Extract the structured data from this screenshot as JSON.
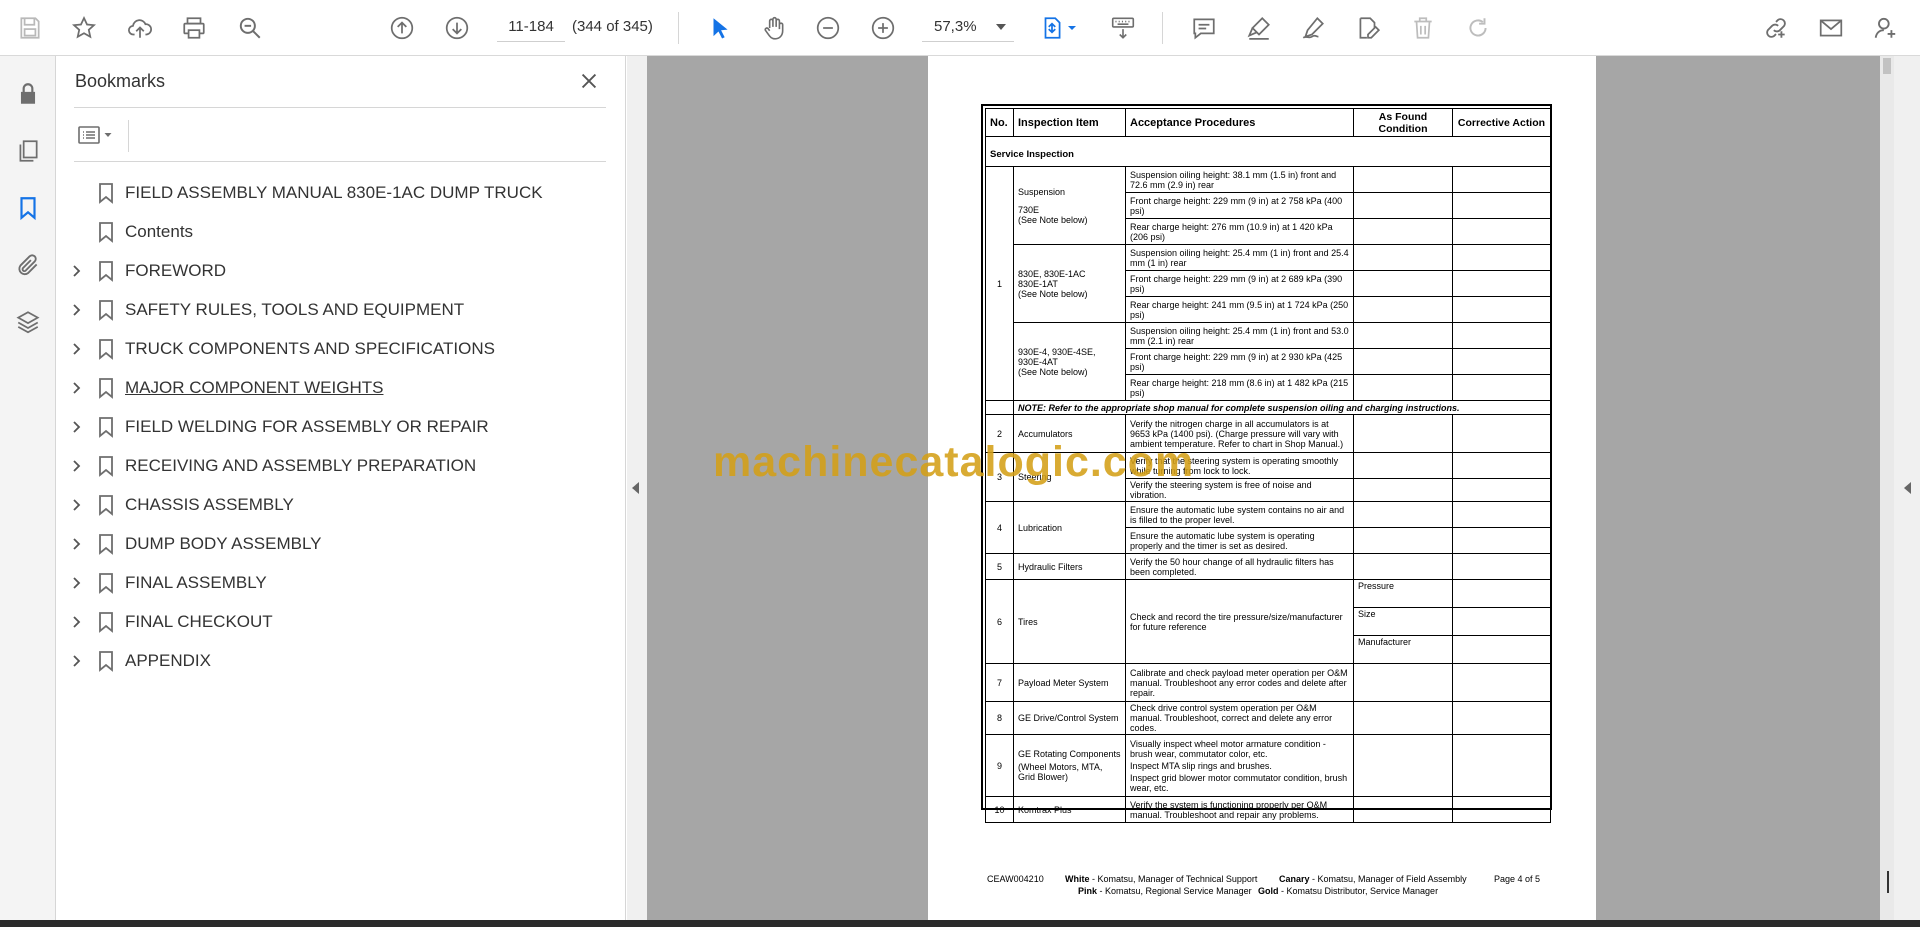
{
  "toolbar": {
    "page_input": "11-184",
    "page_count": "(344 of 345)",
    "zoom": "57,3%"
  },
  "bookmarks": {
    "title": "Bookmarks",
    "items": [
      {
        "label": "FIELD ASSEMBLY MANUAL 830E-1AC  DUMP TRUCK",
        "expandable": false
      },
      {
        "label": "Contents",
        "expandable": false
      },
      {
        "label": "FOREWORD",
        "expandable": true
      },
      {
        "label": "SAFETY RULES, TOOLS AND EQUIPMENT",
        "expandable": true
      },
      {
        "label": "TRUCK COMPONENTS AND SPECIFICATIONS",
        "expandable": true
      },
      {
        "label": "MAJOR COMPONENT WEIGHTS",
        "expandable": true
      },
      {
        "label": "FIELD WELDING FOR ASSEMBLY OR REPAIR",
        "expandable": true
      },
      {
        "label": "RECEIVING AND ASSEMBLY PREPARATION",
        "expandable": true
      },
      {
        "label": "CHASSIS ASSEMBLY",
        "expandable": true
      },
      {
        "label": "DUMP BODY ASSEMBLY",
        "expandable": true
      },
      {
        "label": "FINAL ASSEMBLY",
        "expandable": true
      },
      {
        "label": "FINAL CHECKOUT",
        "expandable": true
      },
      {
        "label": "APPENDIX",
        "expandable": true
      }
    ]
  },
  "document": {
    "headers": {
      "no": "No.",
      "item": "Inspection Item",
      "proc": "Acceptance Procedures",
      "found": "As Found Condition",
      "action": "Corrective Action"
    },
    "section": "Service Inspection",
    "rows": {
      "r1": {
        "num": "1",
        "a_item": "Suspension",
        "a_sub": "730E",
        "a_sub2": "(See Note below)",
        "a_p1": "Suspension oiling height: 38.1 mm (1.5 in) front and 72.6 mm (2.9 in) rear",
        "a_p2": "Front charge height: 229 mm (9 in) at 2 758 kPa (400 psi)",
        "a_p3": "Rear charge height: 276 mm (10.9 in) at 1 420 kPa (206 psi)",
        "b_item": "830E, 830E-1AC",
        "b_sub": "830E-1AT",
        "b_sub2": "(See Note below)",
        "b_p1": "Suspension oiling height: 25.4 mm (1 in) front and 25.4 mm (1 in) rear",
        "b_p2": "Front charge height:  229 mm (9 in) at 2 689 kPa (390 psi)",
        "b_p3": "Rear charge height: 241 mm (9.5 in) at 1 724 kPa (250 psi)",
        "c_item": "930E-4, 930E-4SE, 930E-4AT",
        "c_sub2": "(See Note below)",
        "c_p1": "Suspension oiling height: 25.4 mm (1 in) front and 53.0 mm (2.1 in) rear",
        "c_p2": "Front charge height: 229 mm (9 in) at 2 930 kPa (425 psi)",
        "c_p3": "Rear charge height: 218 mm (8.6 in) at 1 482 kPa (215 psi)",
        "note": "NOTE: Refer to the appropriate shop manual for complete suspension oiling and charging instructions."
      },
      "r2": {
        "num": "2",
        "item": "Accumulators",
        "proc": "Verify the nitrogen charge in all accumulators is at 9653 kPa (1400 psi). (Charge pressure will vary with ambient temperature. Refer to chart in Shop Manual.)"
      },
      "r3": {
        "num": "3",
        "item": "Steering",
        "p1": "Verify that the steering system is operating smoothly while turning from lock to lock.",
        "p2": "Verify the steering system is free of noise and vibration."
      },
      "r4": {
        "num": "4",
        "item": "Lubrication",
        "p1": "Ensure the automatic lube system contains no air and is filled to the proper level.",
        "p2": "Ensure the automatic lube system is operating properly and the timer is set as desired."
      },
      "r5": {
        "num": "5",
        "item": "Hydraulic Filters",
        "proc": "Verify the 50 hour change of all hydraulic filters has been completed."
      },
      "r6": {
        "num": "6",
        "item": "Tires",
        "proc": "Check and record the tire pressure/size/manufacturer for future reference",
        "f1": "Pressure",
        "f2": "Size",
        "f3": "Manufacturer"
      },
      "r7": {
        "num": "7",
        "item": "Payload Meter System",
        "proc": "Calibrate and check payload meter operation per O&M manual. Troubleshoot any error codes and delete after repair."
      },
      "r8": {
        "num": "8",
        "item": "GE Drive/Control System",
        "proc": "Check drive control system operation per O&M manual. Troubleshoot, correct and delete any error codes."
      },
      "r9": {
        "num": "9",
        "item": "GE Rotating Components",
        "sub": "(Wheel Motors, MTA, Grid Blower)",
        "p1": "Visually inspect wheel motor armature condition - brush wear, commutator color, etc.",
        "p2": "Inspect MTA slip rings and brushes.",
        "p3": "Inspect grid blower motor commutator condition, brush wear, etc."
      },
      "r10": {
        "num": "10",
        "item": "Komtrax Plus",
        "proc": "Verify the system is functioning properly per O&M manual. Troubleshoot and repair any problems."
      }
    },
    "footer": {
      "code": "CEAW004210",
      "white_label": "White",
      "white_text": " - Komatsu, Manager of Technical Support",
      "canary_label": "Canary",
      "canary_text": " - Komatsu, Manager of Field Assembly",
      "page": "Page 4 of  5",
      "pink_label": "Pink",
      "pink_text": " - Komatsu, Regional Service Manager",
      "gold_label": "Gold",
      "gold_text": " - Komatsu Distributor, Service Manager"
    }
  },
  "watermark": "machinecatalogic.com",
  "colors": {
    "accent_blue": "#1473e6",
    "icon_gray": "#6e6e6e",
    "viewer_bg": "#a6a6a6",
    "watermark": "#d4a017"
  }
}
